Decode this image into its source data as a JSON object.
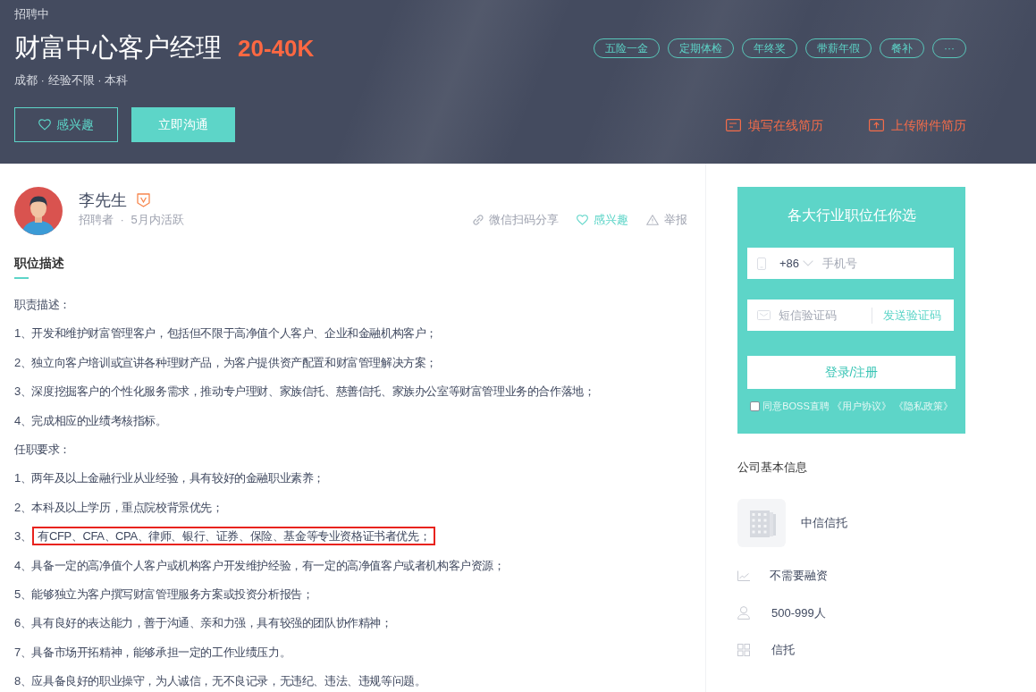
{
  "header": {
    "status": "招聘中",
    "title": "财富中心客户经理",
    "salary": "20-40K",
    "meta": "成都 · 经验不限 · 本科",
    "tags": [
      "五险一金",
      "定期体检",
      "年终奖",
      "带薪年假",
      "餐补",
      "···"
    ],
    "buttons": [
      {
        "kind": "outline",
        "label": "感兴趣"
      },
      {
        "kind": "primary",
        "label": "立即沟通"
      }
    ],
    "links": [
      {
        "kind": "form",
        "label": "填写在线简历"
      },
      {
        "kind": "upload",
        "label": "上传附件简历"
      }
    ]
  },
  "recruiter": {
    "name": "李先生",
    "verified": true,
    "meta": "招聘者 · 5月内活跃",
    "actions": [
      {
        "kind": "share",
        "label": "微信扫码分享"
      },
      {
        "kind": "interest",
        "label": "感兴趣"
      },
      {
        "kind": "report",
        "label": "举报"
      }
    ]
  },
  "description": {
    "heading": "职位描述",
    "sections": [
      {
        "title": "职责描述：",
        "items": [
          {
            "number": "1、",
            "text": "开发和维护财富管理客户，包括但不限于高净值个人客户、企业和金融机构客户；",
            "highlighted": false
          },
          {
            "number": "2、",
            "text": "独立向客户培训或宣讲各种理财产品，为客户提供资产配置和财富管理解决方案；",
            "highlighted": false
          },
          {
            "number": "3、",
            "text": "深度挖掘客户的个性化服务需求，推动专户理财、家族信托、慈善信托、家族办公室等财富管理业务的合作落地；",
            "highlighted": false
          },
          {
            "number": "4、",
            "text": "完成相应的业绩考核指标。",
            "highlighted": false
          }
        ]
      },
      {
        "title": "任职要求：",
        "items": [
          {
            "number": "1、",
            "text": "两年及以上金融行业从业经验，具有较好的金融职业素养；",
            "highlighted": false
          },
          {
            "number": "2、",
            "text": "本科及以上学历，重点院校背景优先；",
            "highlighted": false
          },
          {
            "number": "3、",
            "text": "有CFP、CFA、CPA、律师、银行、证券、保险、基金等专业资格证书者优先；",
            "highlighted": true
          },
          {
            "number": "4、",
            "text": "具备一定的高净值个人客户或机构客户开发维护经验，有一定的高净值客户或者机构客户资源；",
            "highlighted": false
          },
          {
            "number": "5、",
            "text": "能够独立为客户撰写财富管理服务方案或投资分析报告；",
            "highlighted": false
          },
          {
            "number": "6、",
            "text": "具有良好的表达能力，善于沟通、亲和力强，具有较强的团队协作精神；",
            "highlighted": false
          },
          {
            "number": "7、",
            "text": "具备市场开拓精神，能够承担一定的工作业绩压力。",
            "highlighted": false
          },
          {
            "number": "8、",
            "text": "应具备良好的职业操守，为人诚信，无不良记录，无违纪、违法、违规等问题。",
            "highlighted": false
          }
        ]
      }
    ]
  },
  "login_panel": {
    "title": "各大行业职位任你选",
    "phone": {
      "country_code": "+86",
      "placeholder": "手机号"
    },
    "code": {
      "placeholder": "短信验证码",
      "send_label": "发送验证码"
    },
    "submit": "登录/注册",
    "agreement": {
      "checked": false,
      "text": "同意BOSS直聘",
      "links": [
        "《用户协议》",
        "《隐私政策》"
      ]
    }
  },
  "company": {
    "title": "公司基本信息",
    "name": "中信信托",
    "facts": [
      {
        "kind": "funding",
        "text": "不需要融资"
      },
      {
        "kind": "size",
        "text": "500-999人"
      },
      {
        "kind": "industry",
        "text": "信托"
      }
    ]
  }
}
